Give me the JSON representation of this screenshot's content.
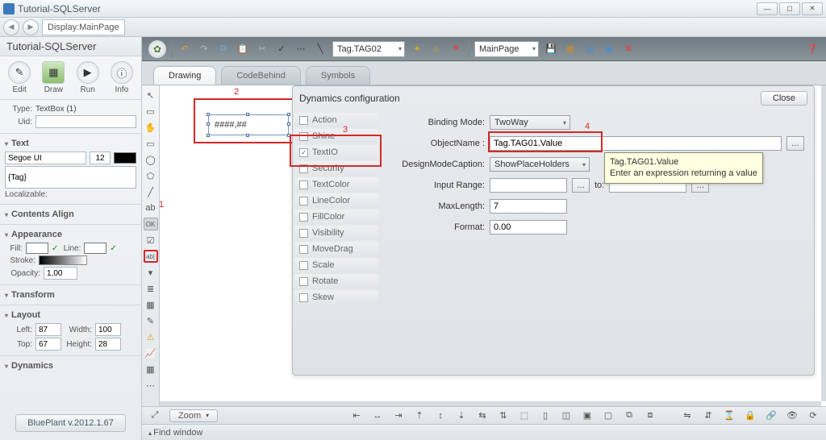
{
  "window": {
    "title": "Tutorial-SQLServer",
    "breadcrumb": "Display:MainPage"
  },
  "leftpanel": {
    "title": "Tutorial-SQLServer",
    "bigbuttons": {
      "edit": "Edit",
      "draw": "Draw",
      "run": "Run",
      "info": "Info"
    },
    "type_label": "Type:",
    "type_value": "TextBox (1)",
    "uid_label": "Uid:",
    "uid_value": "",
    "text_head": "Text",
    "font": "Segoe UI",
    "fontsize": "12",
    "tag_placeholder": "{Tag}",
    "localizable": "Localizable:",
    "contents_head": "Contents Align",
    "appearance_head": "Appearance",
    "fill_label": "Fill:",
    "line_label": "Line:",
    "stroke_label": "Stroke:",
    "opacity_label": "Opacity:",
    "opacity_value": "1,00",
    "transform_head": "Transform",
    "layout_head": "Layout",
    "left_label": "Left:",
    "left_value": "87",
    "width_label": "Width:",
    "width_value": "100",
    "top_label": "Top:",
    "top_value": "67",
    "height_label": "Height:",
    "height_value": "28",
    "dynamics_head": "Dynamics",
    "version": "BluePlant  v.2012.1.67"
  },
  "ribbon": {
    "tagdd": "Tag.TAG02",
    "pagedd": "MainPage"
  },
  "tabs": {
    "drawing": "Drawing",
    "codebehind": "CodeBehind",
    "symbols": "Symbols"
  },
  "canvas": {
    "textbox_sample": "####,##"
  },
  "annotations": {
    "n1": "1",
    "n2": "2",
    "n3": "3",
    "n4": "4"
  },
  "dialog": {
    "title": "Dynamics configuration",
    "close": "Close",
    "items": {
      "action": "Action",
      "shine": "Shine",
      "textio": "TextIO",
      "security": "Security",
      "textcolor": "TextColor",
      "linecolor": "LineColor",
      "fillcolor": "FillColor",
      "visibility": "Visibility",
      "movedrag": "MoveDrag",
      "scale": "Scale",
      "rotate": "Rotate",
      "skew": "Skew"
    },
    "binding_label": "Binding Mode:",
    "binding_value": "TwoWay",
    "object_label": "ObjectName :",
    "object_value": "Tag.TAG01.Value",
    "design_label": "DesignModeCaption:",
    "design_value": "ShowPlaceHolders",
    "range_label": "Input Range:",
    "range_to": "to:",
    "range_from": "",
    "range_to_val": "",
    "maxlen_label": "MaxLength:",
    "maxlen_value": "7",
    "format_label": "Format:",
    "format_value": "0.00",
    "tooltip_title": "Tag.TAG01.Value",
    "tooltip_body": "Enter an expression returning a value"
  },
  "bottom": {
    "zoom": "Zoom",
    "find": "Find window"
  }
}
